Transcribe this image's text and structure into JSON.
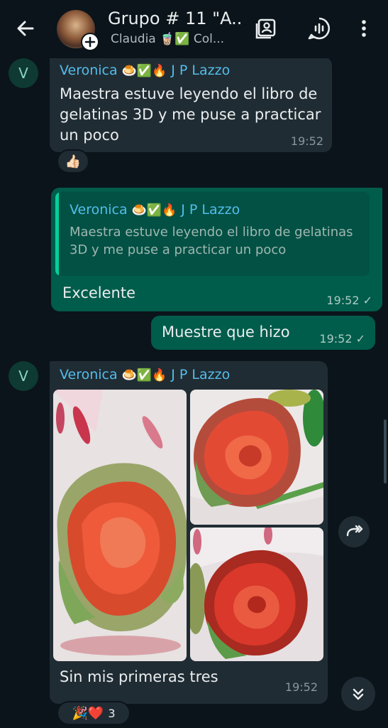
{
  "header": {
    "title": "Grupo # 11 \"A...",
    "subtitle": "Claudia 🧋✅ Col..."
  },
  "messages": {
    "m1": {
      "sender": "Veronica",
      "sender_emojis": "🍮✅🔥",
      "sender_suffix": " J P Lazzo",
      "avatar_letter": "V",
      "text": "Maestra estuve leyendo el libro de gelatinas 3D y me puse a practicar un poco",
      "time": "19:52",
      "reaction": "👍🏻"
    },
    "m2": {
      "quoted_sender": "Veronica",
      "quoted_sender_emojis": "🍮✅🔥",
      "quoted_sender_suffix": " J P Lazzo",
      "quoted_text": "Maestra estuve leyendo el libro de gelatinas 3D y me puse a practicar un poco",
      "text": "Excelente",
      "time": "19:52",
      "status": "✓"
    },
    "m3": {
      "text": "Muestre que hizo",
      "time": "19:52",
      "status": "✓"
    },
    "m4": {
      "sender": "Veronica",
      "sender_emojis": "🍮✅🔥",
      "sender_suffix": " J P Lazzo",
      "avatar_letter": "V",
      "caption": "Sin mis primeras tres",
      "time": "19:52",
      "reaction_emojis": "🎉❤️",
      "reaction_count": "3"
    }
  },
  "colors": {
    "background": "#0b141a",
    "incoming_bubble": "#202c33",
    "outgoing_bubble": "#005c4b",
    "sender_name": "#53bdeb",
    "quote_bar": "#06cf9c"
  },
  "icons": [
    "back-arrow-icon",
    "group-avatar",
    "add-icon",
    "contact-card-icon",
    "voice-chat-icon",
    "more-vert-icon",
    "forward-icon",
    "scroll-down-icon"
  ]
}
